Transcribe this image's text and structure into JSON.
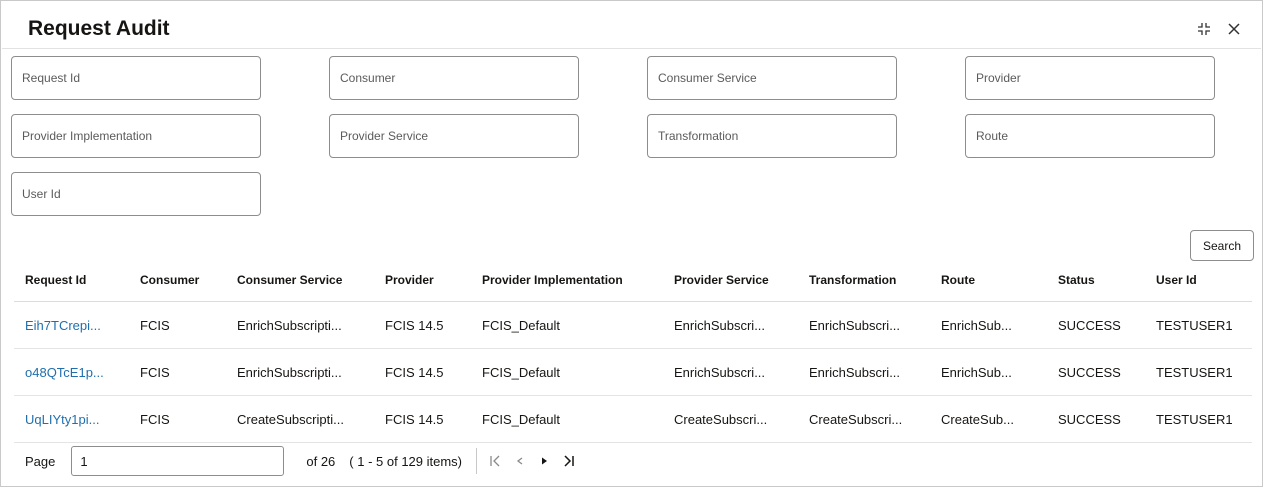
{
  "dialog": {
    "title": "Request Audit"
  },
  "filters": {
    "request_id": "Request Id",
    "consumer": "Consumer",
    "consumer_service": "Consumer Service",
    "provider": "Provider",
    "provider_implementation": "Provider Implementation",
    "provider_service": "Provider Service",
    "transformation": "Transformation",
    "route": "Route",
    "user_id": "User Id"
  },
  "search_label": "Search",
  "table": {
    "headers": [
      "Request Id",
      "Consumer",
      "Consumer Service",
      "Provider",
      "Provider Implementation",
      "Provider Service",
      "Transformation",
      "Route",
      "Status",
      "User Id"
    ],
    "rows": [
      [
        "Eih7TCrepi...",
        "FCIS",
        "EnrichSubscripti...",
        "FCIS 14.5",
        "FCIS_Default",
        "EnrichSubscri...",
        "EnrichSubscri...",
        "EnrichSub...",
        "SUCCESS",
        "TESTUSER1"
      ],
      [
        "o48QTcE1p...",
        "FCIS",
        "EnrichSubscripti...",
        "FCIS 14.5",
        "FCIS_Default",
        "EnrichSubscri...",
        "EnrichSubscri...",
        "EnrichSub...",
        "SUCCESS",
        "TESTUSER1"
      ],
      [
        "UqLIYty1pi...",
        "FCIS",
        "CreateSubscripti...",
        "FCIS 14.5",
        "FCIS_Default",
        "CreateSubscri...",
        "CreateSubscri...",
        "CreateSub...",
        "SUCCESS",
        "TESTUSER1"
      ]
    ]
  },
  "pagination": {
    "label": "Page",
    "current": "1",
    "of_text": "of 26",
    "items_text": "( 1 - 5 of 129 items)"
  }
}
